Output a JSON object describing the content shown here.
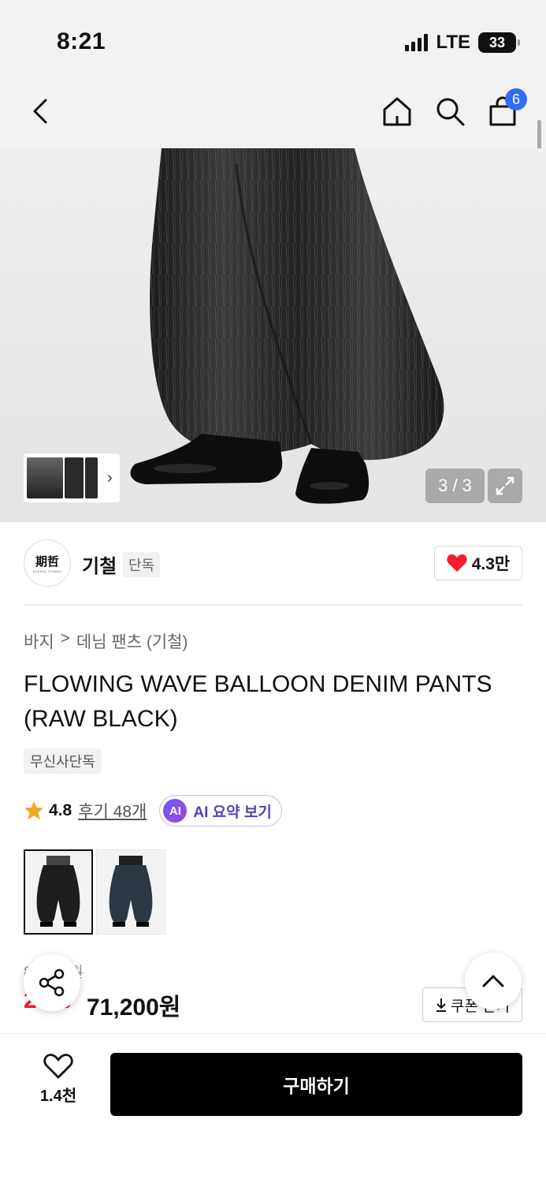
{
  "status_bar": {
    "time": "8:21",
    "network": "LTE",
    "battery": "33"
  },
  "nav": {
    "cart_count": "6"
  },
  "gallery": {
    "page_counter": "3 / 3"
  },
  "brand": {
    "logo_text": "期哲",
    "logo_subtext": "KIICHUL STUDIO",
    "name": "기철",
    "tag": "단독",
    "like_count": "4.3만"
  },
  "breadcrumb": {
    "category": "바지",
    "separator": ">",
    "subcategory": "데님 팬츠 (기철)"
  },
  "product": {
    "title": "FLOWING WAVE BALLOON DENIM PANTS (RAW BLACK)",
    "exclusive_tag": "무신사단독",
    "rating": "4.8",
    "review_link": "후기 48개",
    "ai_badge": "AI",
    "ai_summary_label": "AI 요약 보기"
  },
  "price": {
    "original": "89,000원",
    "discount_rate": "20%",
    "sale_price": "71,200원",
    "coupon_label": "쿠폰 받기"
  },
  "bottom_bar": {
    "wish_count": "1.4천",
    "buy_label": "구매하기"
  }
}
